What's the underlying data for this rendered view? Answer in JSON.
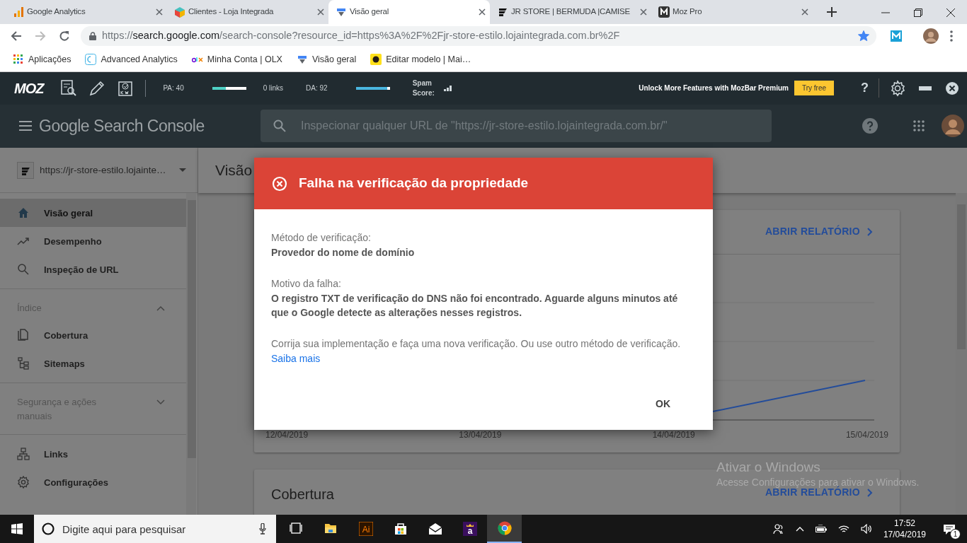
{
  "browser": {
    "tabs": [
      {
        "title": "Google Analytics",
        "selected": false
      },
      {
        "title": "Clientes - Loja Integrada",
        "selected": false
      },
      {
        "title": "Visão geral",
        "selected": true
      },
      {
        "title": "JR STORE | BERMUDA |CAMISE",
        "selected": false
      },
      {
        "title": "Moz Pro",
        "selected": false
      }
    ],
    "nav": {
      "back_disabled": false,
      "forward_disabled": true
    },
    "address": {
      "scheme": "https://",
      "host": "search.google.com",
      "path": "/search-console?resource_id=https%3A%2F%2Fjr-store-estilo.lojaintegrada.com.br%2F",
      "bookmarked": true
    },
    "bookmarks": [
      "Aplicações",
      "Advanced Analytics",
      "Minha Conta | OLX",
      "Visão geral",
      "Editar modelo | Mai…"
    ]
  },
  "mozbar": {
    "logo": "MOZ",
    "metrics": [
      {
        "label": "PA: 40",
        "level": 0.4,
        "reading": "0 links"
      },
      {
        "label": "DA: 92",
        "level": 0.92
      }
    ],
    "spam_label": "Spam Score:",
    "promo": "Unlock More Features with MozBar Premium",
    "promo_button": "Try free",
    "help": "?"
  },
  "console": {
    "logo": "Google Search Console",
    "search_placeholder": "Inspecionar qualquer URL de \"https://jr-store-estilo.lojaintegrada.com.br/\""
  },
  "sidebar": {
    "property": "https://jr-store-estilo.lojainte…",
    "groups": [
      {
        "items": [
          {
            "label": "Visão geral",
            "selected": true
          },
          {
            "label": "Desempenho",
            "selected": false
          },
          {
            "label": "Inspeção de URL",
            "selected": false
          }
        ]
      },
      {
        "title": "Índice",
        "expanded": true,
        "items": [
          {
            "label": "Cobertura",
            "selected": false
          },
          {
            "label": "Sitemaps",
            "selected": false
          }
        ]
      },
      {
        "title": "Segurança e ações manuais",
        "expanded": false
      },
      {
        "items": [
          {
            "label": "Links",
            "selected": false
          },
          {
            "label": "Configurações",
            "selected": false
          }
        ]
      }
    ]
  },
  "page": {
    "title": "Visão",
    "cards": [
      {
        "action": "ABRIR RELATÓRIO",
        "dates": [
          "12/04/2019",
          "13/04/2019",
          "14/04/2019",
          "15/04/2019"
        ]
      },
      {
        "title": "Cobertura",
        "action": "ABRIR RELATÓRIO"
      }
    ]
  },
  "dialog": {
    "title": "Falha na verificação da propriedade",
    "fields": [
      {
        "label": "Método de verificação:",
        "value": "Provedor do nome de domínio"
      },
      {
        "label": "Motivo da falha:",
        "value": "O registro TXT de verificação do DNS não foi encontrado. Aguarde alguns minutos até que o Google detecte as alterações nesses registros."
      }
    ],
    "note": "Corrija sua implementação e faça uma nova verificação. Ou use outro método de verificação.",
    "link": "Saiba mais",
    "button": "OK"
  },
  "watermark": {
    "title": "Ativar o Windows",
    "text": "Acesse Configurações para ativar o Windows."
  },
  "taskbar": {
    "search_placeholder": "Digite aqui para pesquisar",
    "apps": [
      {
        "selected": false
      },
      {
        "selected": false
      },
      {
        "glyph": "Ai",
        "selected": false
      },
      {
        "selected": false
      },
      {
        "selected": false
      },
      {
        "glyph": "a",
        "selected": false
      },
      {
        "selected": true
      }
    ],
    "time": "17:52",
    "date": "17/04/2019",
    "notifications": "1"
  }
}
